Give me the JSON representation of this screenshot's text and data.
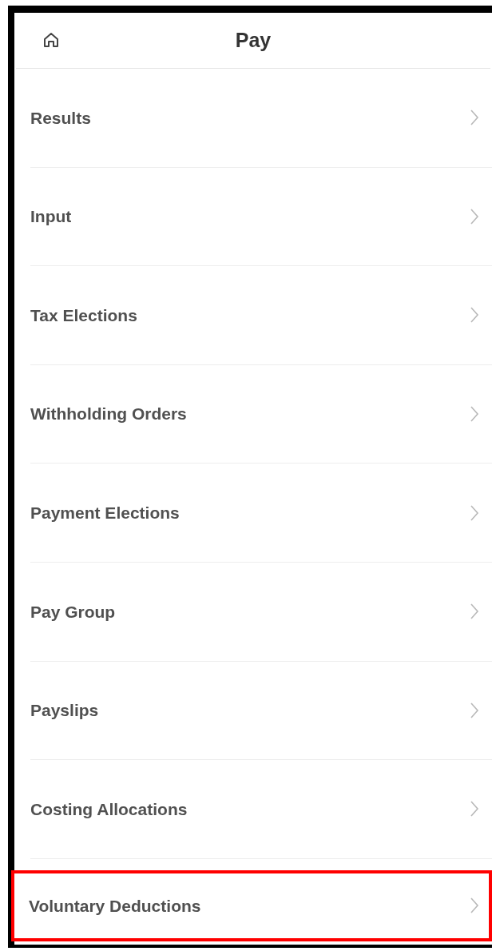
{
  "header": {
    "title": "Pay"
  },
  "items": [
    {
      "label": "Results",
      "highlighted": false
    },
    {
      "label": "Input",
      "highlighted": false
    },
    {
      "label": "Tax Elections",
      "highlighted": false
    },
    {
      "label": "Withholding Orders",
      "highlighted": false
    },
    {
      "label": "Payment Elections",
      "highlighted": false
    },
    {
      "label": "Pay Group",
      "highlighted": false
    },
    {
      "label": "Payslips",
      "highlighted": false
    },
    {
      "label": "Costing Allocations",
      "highlighted": false
    },
    {
      "label": "Voluntary Deductions",
      "highlighted": true
    }
  ]
}
